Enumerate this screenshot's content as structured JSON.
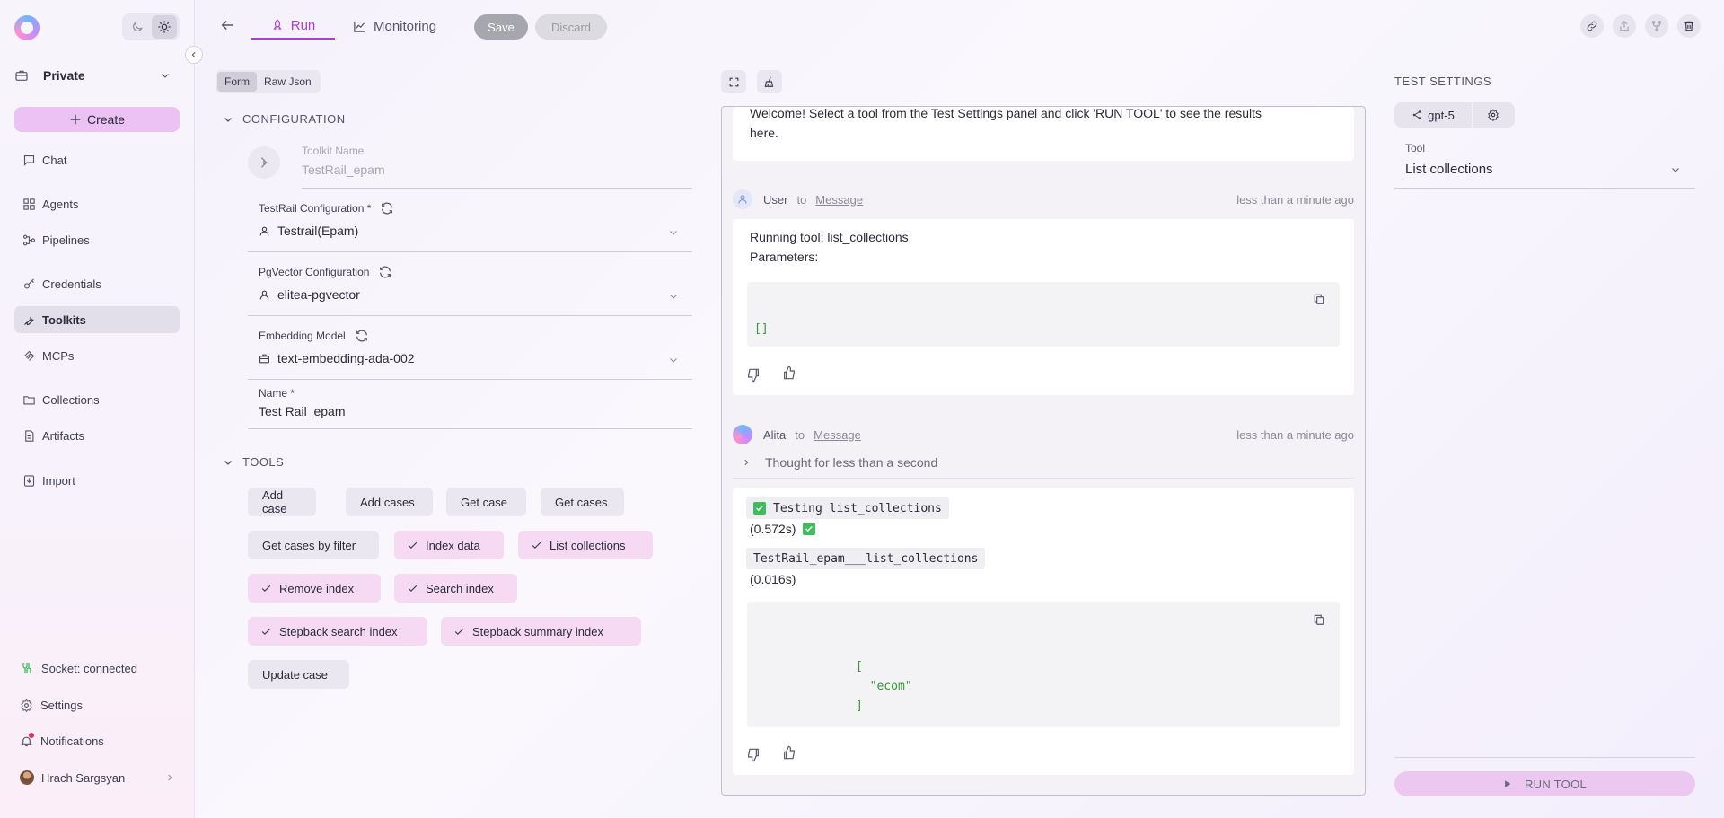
{
  "sidebar": {
    "project": "Private",
    "create_label": "Create",
    "items": [
      {
        "label": "Chat",
        "icon": "chat-icon"
      },
      {
        "label": "Agents",
        "icon": "agents-icon"
      },
      {
        "label": "Pipelines",
        "icon": "pipelines-icon"
      },
      {
        "label": "Credentials",
        "icon": "credentials-icon"
      },
      {
        "label": "Toolkits",
        "icon": "toolkits-icon",
        "active": true
      },
      {
        "label": "MCPs",
        "icon": "mcps-icon"
      },
      {
        "label": "Collections",
        "icon": "collections-icon"
      },
      {
        "label": "Artifacts",
        "icon": "artifacts-icon"
      },
      {
        "label": "Import",
        "icon": "import-icon"
      }
    ],
    "bottom": {
      "socket": "Socket: connected",
      "settings": "Settings",
      "notifications": "Notifications",
      "user": "Hrach Sargsyan"
    }
  },
  "topbar": {
    "tabs": [
      {
        "label": "Run",
        "active": true
      },
      {
        "label": "Monitoring"
      }
    ],
    "save_label": "Save",
    "discard_label": "Discard"
  },
  "form": {
    "modes": [
      "Form",
      "Raw Json"
    ],
    "configuration_title": "CONFIGURATION",
    "toolkit_name_label": "Toolkit Name",
    "toolkit_name_placeholder": "TestRail_epam",
    "testrail_config_label": "TestRail Configuration *",
    "testrail_config_value": "Testrail(Epam)",
    "pgvector_label": "PgVector Configuration",
    "pgvector_value": "elitea-pgvector",
    "embedding_label": "Embedding Model",
    "embedding_value": "text-embedding-ada-002",
    "name_label": "Name *",
    "name_value": "Test Rail_epam",
    "tools_title": "TOOLS",
    "tools": [
      {
        "label": "Add case",
        "selected": false
      },
      {
        "label": "Add cases",
        "selected": false
      },
      {
        "label": "Get case",
        "selected": false
      },
      {
        "label": "Get cases",
        "selected": false
      },
      {
        "label": "Get cases by filter",
        "selected": false
      },
      {
        "label": "Index data",
        "selected": true
      },
      {
        "label": "List collections",
        "selected": true
      },
      {
        "label": "Remove index",
        "selected": true
      },
      {
        "label": "Search index",
        "selected": true
      },
      {
        "label": "Stepback search index",
        "selected": true
      },
      {
        "label": "Stepback summary index",
        "selected": true
      },
      {
        "label": "Update case",
        "selected": false
      }
    ]
  },
  "chat": {
    "welcome_line1": "Welcome! Select a tool from the Test Settings panel and click 'RUN TOOL' to see the results",
    "welcome_line2": "here.",
    "user_msg": {
      "author": "User",
      "to": "to",
      "target": "Message",
      "time": "less than a minute ago",
      "line1": "Running tool: list_collections",
      "line2": "Parameters:",
      "code": "[]"
    },
    "alita_msg": {
      "author": "Alita",
      "to": "to",
      "target": "Message",
      "time": "less than a minute ago",
      "thought": "Thought for less than a second",
      "testing_code": "Testing list_collections",
      "timing1": "(0.572s)",
      "call_code": "TestRail_epam___list_collections",
      "timing2": "(0.016s)",
      "result_code": "[\n  \"ecom\"\n]"
    }
  },
  "settings": {
    "title": "TEST SETTINGS",
    "model": "gpt-5",
    "tool_label": "Tool",
    "tool_value": "List collections",
    "run_label": "RUN TOOL"
  },
  "colors": {
    "accent": "#b03bd4",
    "create_bg": "#ebc2f3",
    "chip_selected_bg": "#f6daf3",
    "success": "#3fbd5c",
    "code_green": "#2f9b2f"
  }
}
